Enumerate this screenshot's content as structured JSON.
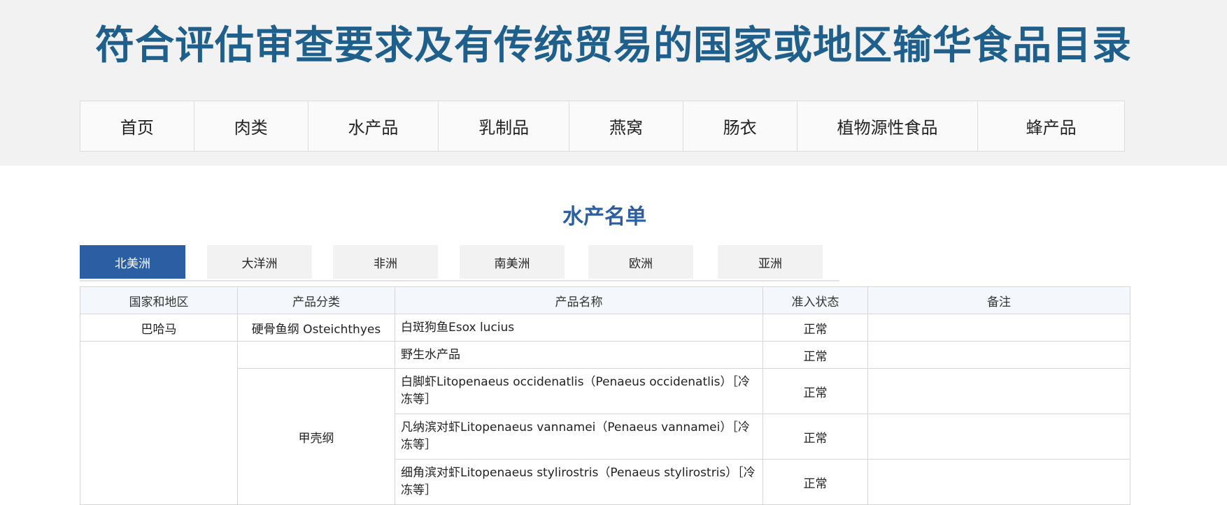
{
  "header": {
    "title": "符合评估审查要求及有传统贸易的国家或地区输华食品目录"
  },
  "nav": {
    "items": [
      "首页",
      "肉类",
      "水产品",
      "乳制品",
      "燕窝",
      "肠衣",
      "植物源性食品",
      "蜂产品"
    ]
  },
  "section": {
    "title": "水产名单"
  },
  "tabs": {
    "items": [
      "北美洲",
      "大洋洲",
      "非洲",
      "南美洲",
      "欧洲",
      "亚洲"
    ],
    "active": "北美洲"
  },
  "table": {
    "columns": [
      "国家和地区",
      "产品分类",
      "产品名称",
      "准入状态",
      "备注"
    ],
    "rows": [
      {
        "country": "巴哈马",
        "category": "硬骨鱼纲 Osteichthyes",
        "product": "白斑狗鱼Esox lucius",
        "status": "正常",
        "note": ""
      },
      {
        "country": "",
        "category": "",
        "product": "野生水产品",
        "status": "正常",
        "note": ""
      },
      {
        "country": "",
        "category": "甲壳纲",
        "product": "白脚虾Litopenaeus occidenatlis（Penaeus occidenatlis）［冷冻等］",
        "status": "正常",
        "note": ""
      },
      {
        "country": "",
        "category": "",
        "product": "凡纳滨对虾Litopenaeus vannamei（Penaeus vannamei）［冷冻等］",
        "status": "正常",
        "note": ""
      },
      {
        "country": "",
        "category": "",
        "product": "细角滨对虾Litopenaeus stylirostris（Penaeus stylirostris）［冷冻等］",
        "status": "正常",
        "note": ""
      }
    ]
  }
}
